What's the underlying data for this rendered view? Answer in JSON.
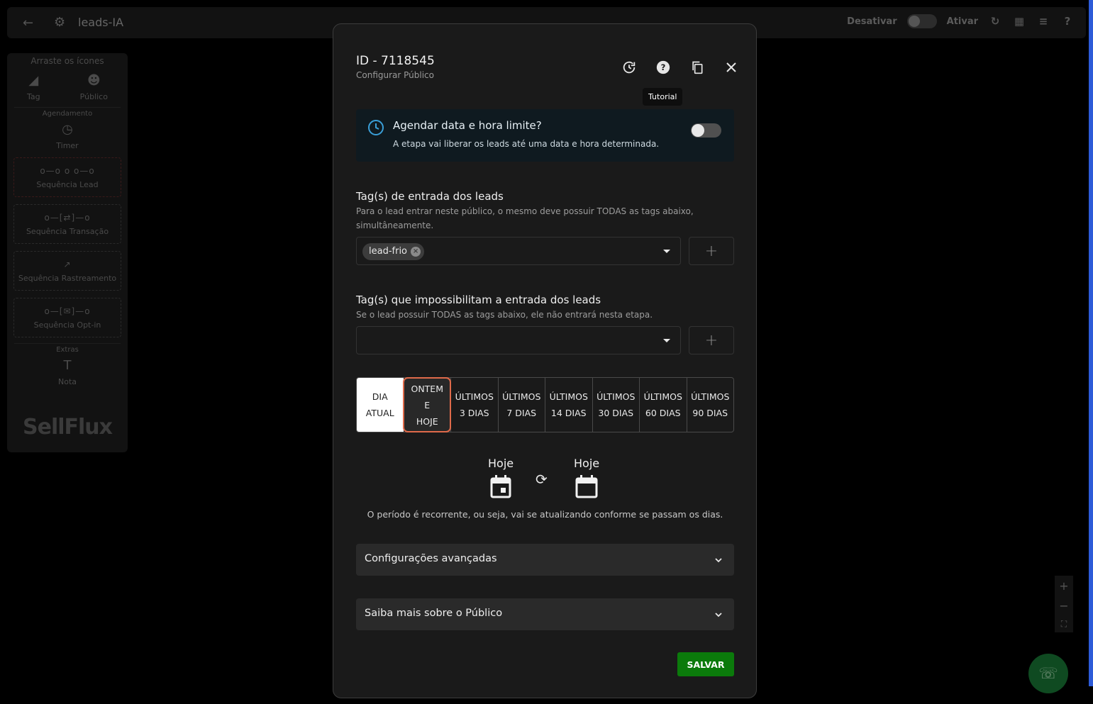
{
  "topbar": {
    "title": "leads-IA",
    "deactivate_label": "Desativar",
    "activate_label": "Ativar"
  },
  "sidebar": {
    "header": "Arraste os ícones",
    "items_top": [
      {
        "label": "Tag",
        "icon": "tag-icon"
      },
      {
        "label": "Público",
        "icon": "users-icon"
      }
    ],
    "sep_scheduling": "Agendamento",
    "timer_label": "Timer",
    "blocks": [
      {
        "label": "Sequência Lead",
        "icon": "sequence-icon"
      },
      {
        "label": "Sequência Transação",
        "icon": "transaction-icon"
      },
      {
        "label": "Sequência Rastreamento",
        "icon": "tracking-icon"
      },
      {
        "label": "Sequência Opt-in",
        "icon": "optin-icon"
      }
    ],
    "sep_extras": "Extras",
    "note_label": "Nota",
    "logo_text": "SellFlux"
  },
  "modal": {
    "id_label": "ID - 7118545",
    "subtitle": "Configurar Público",
    "tooltip": "Tutorial",
    "schedule": {
      "title": "Agendar data e hora limite?",
      "desc": "A etapa vai liberar os leads até uma data e hora determinada.",
      "enabled": false
    },
    "entry_tags": {
      "title": "Tag(s) de entrada dos leads",
      "desc": "Para o lead entrar neste público, o mesmo deve possuir TODAS as tags abaixo, simultâneamente.",
      "chips": [
        "lead-frio"
      ]
    },
    "block_tags": {
      "title": "Tag(s) que impossibilitam a entrada dos leads",
      "desc": "Se o lead possuir TODAS as tags abaixo, ele não entrará nesta etapa."
    },
    "periods": [
      "DIA\nATUAL",
      "ONTEM\nE\nHOJE",
      "ÚLTIMOS\n3 DIAS",
      "ÚLTIMOS\n7 DIAS",
      "ÚLTIMOS\n14 DIAS",
      "ÚLTIMOS\n30 DIAS",
      "ÚLTIMOS\n60 DIAS",
      "ÚLTIMOS\n90 DIAS"
    ],
    "selected_period": 0,
    "highlighted_period": 1,
    "date_from": "Hoje",
    "date_to": "Hoje",
    "recurrent_note": "O período é recorrente, ou seja, vai se atualizando conforme se passam os dias.",
    "advanced_label": "Configurações avançadas",
    "learn_more_label": "Saiba mais sobre o Público",
    "save_label": "SALVAR"
  },
  "colors": {
    "accent_save": "#0b7a0b",
    "highlight_outline": "#e06a4a",
    "whatsapp": "#0f4a21"
  }
}
